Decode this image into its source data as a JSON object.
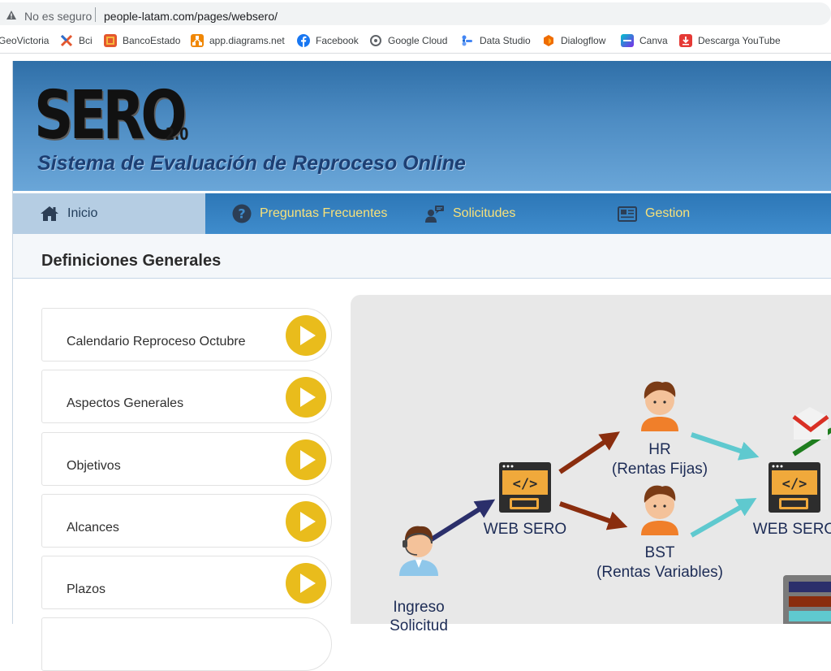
{
  "browser": {
    "not_secure": "No es seguro",
    "url": "people-latam.com/pages/websero/",
    "bookmarks": [
      {
        "label": "GeoVictoria",
        "icon": "geovictoria-icon"
      },
      {
        "label": "Bci",
        "icon": "bci-icon"
      },
      {
        "label": "BancoEstado",
        "icon": "bancoestado-icon"
      },
      {
        "label": "app.diagrams.net",
        "icon": "diagrams-icon"
      },
      {
        "label": "Facebook",
        "icon": "facebook-icon"
      },
      {
        "label": "Google Cloud",
        "icon": "google-cloud-icon"
      },
      {
        "label": "Data Studio",
        "icon": "data-studio-icon"
      },
      {
        "label": "Dialogflow",
        "icon": "dialogflow-icon"
      },
      {
        "label": "Canva",
        "icon": "canva-icon"
      },
      {
        "label": "Descarga YouTube",
        "icon": "download-icon"
      }
    ]
  },
  "header": {
    "logo": "SERO",
    "version": "2.0",
    "tagline": "Sistema de Evaluación de Reproceso Online"
  },
  "nav": [
    {
      "label": "Inicio",
      "icon": "home-icon",
      "active": true
    },
    {
      "label": "Preguntas Frecuentes",
      "icon": "question-icon",
      "active": false
    },
    {
      "label": "Solicitudes",
      "icon": "user-chat-icon",
      "active": false
    },
    {
      "label": "Gestion",
      "icon": "newspaper-icon",
      "active": false
    }
  ],
  "section": {
    "title": "Definiciones Generales",
    "items": [
      {
        "label": "Calendario Reproceso Octubre"
      },
      {
        "label": "Aspectos Generales"
      },
      {
        "label": "Objetivos"
      },
      {
        "label": "Alcances"
      },
      {
        "label": "Plazos"
      }
    ]
  },
  "diagram": {
    "web_sero_left": "WEB SERO",
    "web_sero_right": "WEB SERO",
    "hr": "HR",
    "hr_sub": "(Rentas Fijas)",
    "bst": "BST",
    "bst_sub": "(Rentas Variables)",
    "ingreso": "Ingreso",
    "solicitud": "Solicitud"
  },
  "colors": {
    "accent_yellow": "#e9bc1c",
    "nav_blue": "#3582c1",
    "nav_text": "#f7e17a",
    "arrow_navy": "#2b2f6b",
    "arrow_brown": "#8a2d0e",
    "arrow_teal": "#5fc9cf"
  }
}
